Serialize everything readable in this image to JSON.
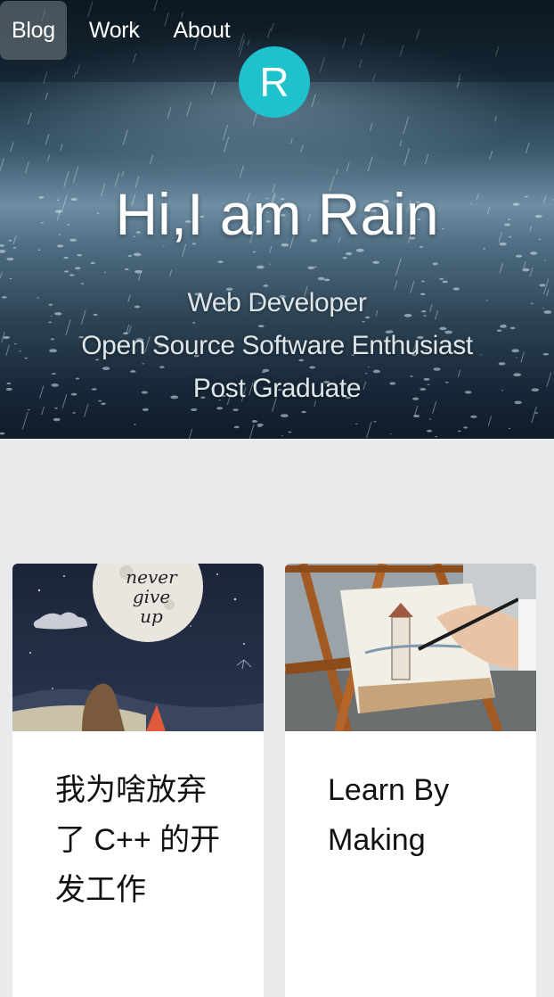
{
  "nav": {
    "items": [
      {
        "label": "Blog",
        "active": true
      },
      {
        "label": "Work",
        "active": false
      },
      {
        "label": "About",
        "active": false
      }
    ]
  },
  "avatar": {
    "letter": "R",
    "color": "#1fc2cc"
  },
  "hero": {
    "title": "Hi,I am Rain",
    "lines": [
      "Web Developer",
      "Open Source Software Enthusiast",
      "Post Graduate"
    ]
  },
  "posts": [
    {
      "title": "我为啥放弃了 C++ 的开发工作",
      "image_text": "never give up",
      "image_icon": "moon-illustration-icon"
    },
    {
      "title": "Learn By Making",
      "image_icon": "painting-easel-icon"
    }
  ],
  "colors": {
    "page_background": "#e9eaec",
    "accent": "#1fc2cc",
    "card_background": "#ffffff"
  }
}
